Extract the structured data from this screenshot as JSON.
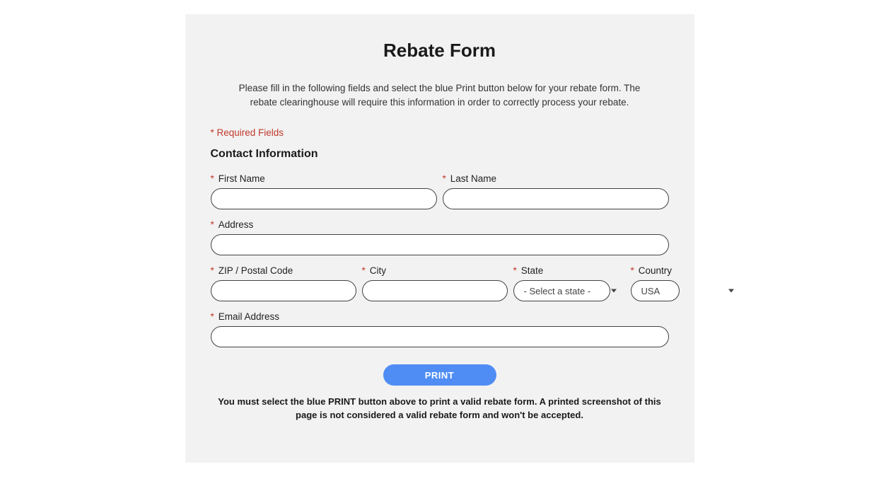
{
  "title": "Rebate Form",
  "intro": "Please fill in the following fields and select the blue Print button below for your rebate form. The rebate clearinghouse will require this information in order to correctly process your rebate.",
  "required_note": "* Required Fields",
  "section_heading": "Contact Information",
  "fields": {
    "first_name": {
      "label": "First Name",
      "value": ""
    },
    "last_name": {
      "label": "Last Name",
      "value": ""
    },
    "address": {
      "label": "Address",
      "value": ""
    },
    "zip": {
      "label": "ZIP / Postal Code",
      "value": ""
    },
    "city": {
      "label": "City",
      "value": ""
    },
    "state": {
      "label": "State",
      "placeholder": "- Select a state -",
      "value": ""
    },
    "country": {
      "label": "Country",
      "value": "USA"
    },
    "email": {
      "label": "Email Address",
      "value": ""
    }
  },
  "print_button": "PRINT",
  "footnote": "You must select the blue PRINT button above to print a valid rebate form. A printed screenshot of this page is not considered a valid rebate form and won't be accepted.",
  "asterisk": "*"
}
